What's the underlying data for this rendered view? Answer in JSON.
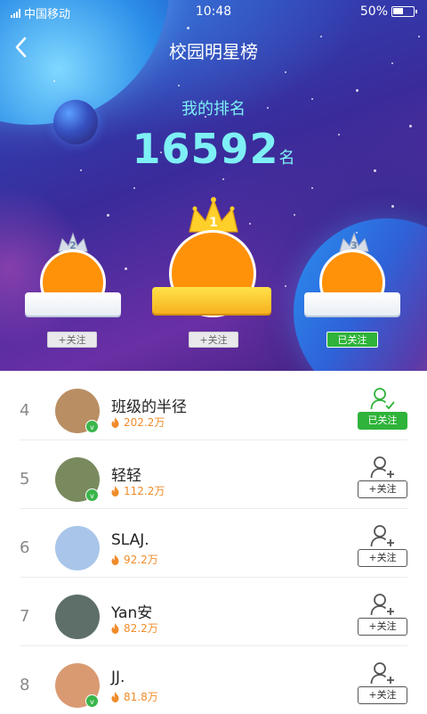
{
  "status_bar": {
    "carrier": "中国移动",
    "time": "10:48",
    "battery": "50%",
    "battery_level": 0.5,
    "network": "3G"
  },
  "nav": {
    "title": "校园明星榜",
    "back_icon": "chevron-left-icon"
  },
  "my_rank": {
    "label": "我的排名",
    "value": "16592",
    "unit": "名"
  },
  "podium": [
    {
      "rank": "2",
      "follow_label": "+关注",
      "followed": false
    },
    {
      "rank": "1",
      "follow_label": "+关注",
      "followed": false
    },
    {
      "rank": "3",
      "follow_label": "已关注",
      "followed": true
    }
  ],
  "list": [
    {
      "rank": "4",
      "name": "班级的半径",
      "score": "202.2万",
      "verified": true,
      "followed": true,
      "action_label": "已关注",
      "avatar_color": "#b98e62"
    },
    {
      "rank": "5",
      "name": "轻轻",
      "score": "112.2万",
      "verified": true,
      "followed": false,
      "action_label": "+关注",
      "avatar_color": "#7a8a5f"
    },
    {
      "rank": "6",
      "name": "SLAJ.",
      "score": "92.2万",
      "verified": false,
      "followed": false,
      "action_label": "+关注",
      "avatar_color": "#a9c6ea"
    },
    {
      "rank": "7",
      "name": "Yan安",
      "score": "82.2万",
      "verified": false,
      "followed": false,
      "action_label": "+关注",
      "avatar_color": "#5e6f6a"
    },
    {
      "rank": "8",
      "name": "JJ.",
      "score": "81.8万",
      "verified": true,
      "followed": false,
      "action_label": "+关注",
      "avatar_color": "#d99a72"
    }
  ],
  "colors": {
    "accent_cyan": "#7ef0f5",
    "follow_green": "#2fb33a",
    "score_orange": "#f08b2a",
    "podium_avatar": "#ff9208"
  }
}
